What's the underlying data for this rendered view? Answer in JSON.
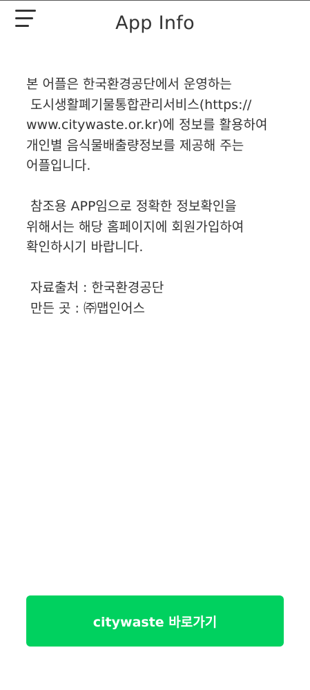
{
  "header": {
    "title": "App Info",
    "menu_icon": "hamburger-menu-icon"
  },
  "info": {
    "paragraph1": [
      "본 어플은 한국환경공단에서 운영하는",
      " 도시생활폐기물통합관리서비스(https://",
      "www.citywaste.or.kr)에 정보를 활용하여",
      "개인별 음식물배출량정보를 제공해 주는",
      "어플입니다."
    ],
    "paragraph2": [
      " 참조용 APP임으로 정확한 정보확인을",
      "위해서는 해당 홈페이지에 회원가입하여",
      "확인하시기 바랍니다."
    ],
    "source": " 자료출처 : 한국환경공단",
    "maker": " 만든 곳 : ㈜맵인어스"
  },
  "cta": {
    "label": "citywaste 바로가기",
    "color": "#00d15f"
  }
}
